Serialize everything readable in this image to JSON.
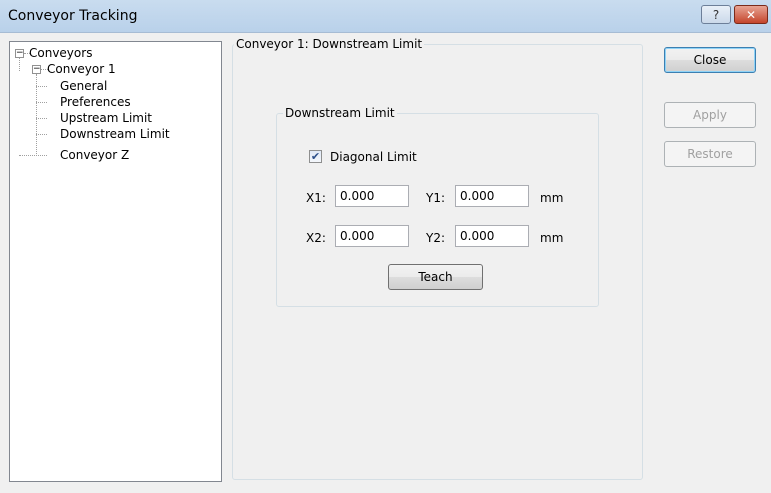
{
  "window": {
    "title": "Conveyor Tracking",
    "help_glyph": "?",
    "close_glyph": "✕"
  },
  "tree": {
    "root": {
      "label": "Conveyors",
      "expander": "−"
    },
    "conveyor1": {
      "label": "Conveyor 1",
      "expander": "−"
    },
    "children": [
      "General",
      "Preferences",
      "Upstream Limit",
      "Downstream Limit"
    ],
    "conveyorZ": {
      "label": "Conveyor Z"
    },
    "selected": "Downstream Limit"
  },
  "panel": {
    "group_title": "Conveyor 1: Downstream Limit",
    "inner_title": "Downstream Limit",
    "diagonal_limit": {
      "label": "Diagonal Limit",
      "checked": true,
      "check_glyph": "✔"
    },
    "x1": {
      "label": "X1:",
      "value": "0.000"
    },
    "y1": {
      "label": "Y1:",
      "value": "0.000"
    },
    "x2": {
      "label": "X2:",
      "value": "0.000"
    },
    "y2": {
      "label": "Y2:",
      "value": "0.000"
    },
    "unit1": "mm",
    "unit2": "mm",
    "teach_label": "Teach"
  },
  "buttons": {
    "close": "Close",
    "apply": "Apply",
    "restore": "Restore"
  }
}
